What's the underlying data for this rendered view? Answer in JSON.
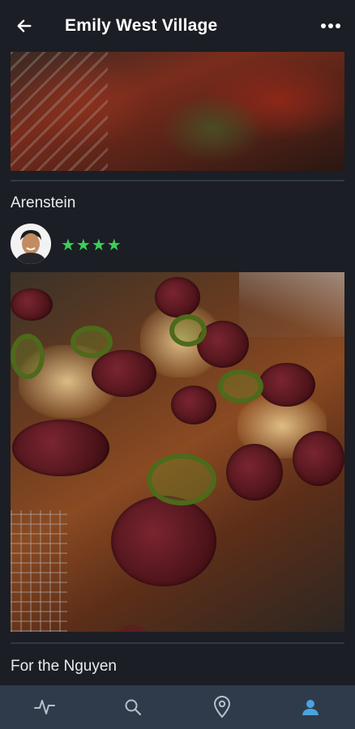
{
  "header": {
    "title": "Emily West Village",
    "back_icon": "arrow-left-icon",
    "more_icon": "more-horizontal-icon"
  },
  "feed": {
    "items": [
      {
        "label": "Arenstein",
        "rating": 4,
        "stars_text": "★★★★",
        "image": "pepperoni-jalapeno-pizza-photo"
      },
      {
        "label": "For the Nguyen"
      }
    ]
  },
  "bottom_nav": {
    "items": [
      {
        "icon": "activity-icon",
        "active": false
      },
      {
        "icon": "search-icon",
        "active": false
      },
      {
        "icon": "location-pin-icon",
        "active": false
      },
      {
        "icon": "profile-icon",
        "active": true
      }
    ]
  },
  "colors": {
    "background": "#1b1e24",
    "nav_background": "#2f3b4a",
    "star": "#3ccf5a",
    "active_nav": "#4aa3df",
    "inactive_nav": "#b7c0ca",
    "divider": "#2f3a48"
  }
}
